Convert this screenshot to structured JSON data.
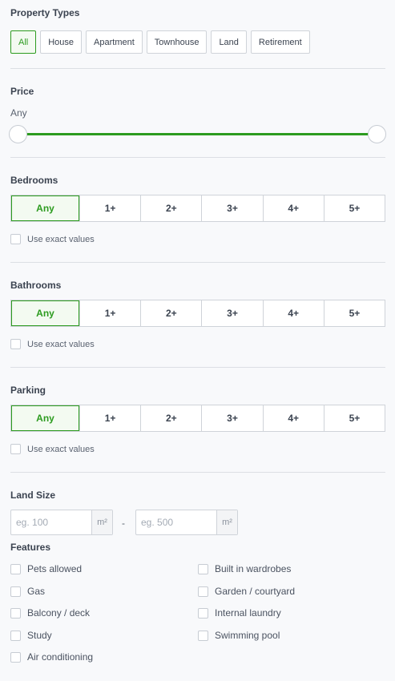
{
  "property_types": {
    "title": "Property Types",
    "options": [
      "All",
      "House",
      "Apartment",
      "Townhouse",
      "Land",
      "Retirement"
    ],
    "selected": "All"
  },
  "price": {
    "title": "Price",
    "value_label": "Any",
    "range_fraction": [
      0,
      1
    ]
  },
  "bedrooms": {
    "title": "Bedrooms",
    "options": [
      "Any",
      "1+",
      "2+",
      "3+",
      "4+",
      "5+"
    ],
    "selected": "Any",
    "exact_label": "Use exact values"
  },
  "bathrooms": {
    "title": "Bathrooms",
    "options": [
      "Any",
      "1+",
      "2+",
      "3+",
      "4+",
      "5+"
    ],
    "selected": "Any",
    "exact_label": "Use exact values"
  },
  "parking": {
    "title": "Parking",
    "options": [
      "Any",
      "1+",
      "2+",
      "3+",
      "4+",
      "5+"
    ],
    "selected": "Any",
    "exact_label": "Use exact values"
  },
  "land_size": {
    "title": "Land Size",
    "min_placeholder": "eg. 100",
    "max_placeholder": "eg. 500",
    "unit": "m²",
    "separator": "-"
  },
  "features": {
    "title": "Features",
    "left": [
      "Pets allowed",
      "Gas",
      "Balcony / deck",
      "Study",
      "Air conditioning"
    ],
    "right": [
      "Built in wardrobes",
      "Garden / courtyard",
      "Internal laundry",
      "Swimming pool"
    ]
  },
  "colors": {
    "accent": "#2c9b1f",
    "accent_bg": "#f3faf1",
    "border": "#cfd3d9",
    "background": "#f8f9fb"
  }
}
